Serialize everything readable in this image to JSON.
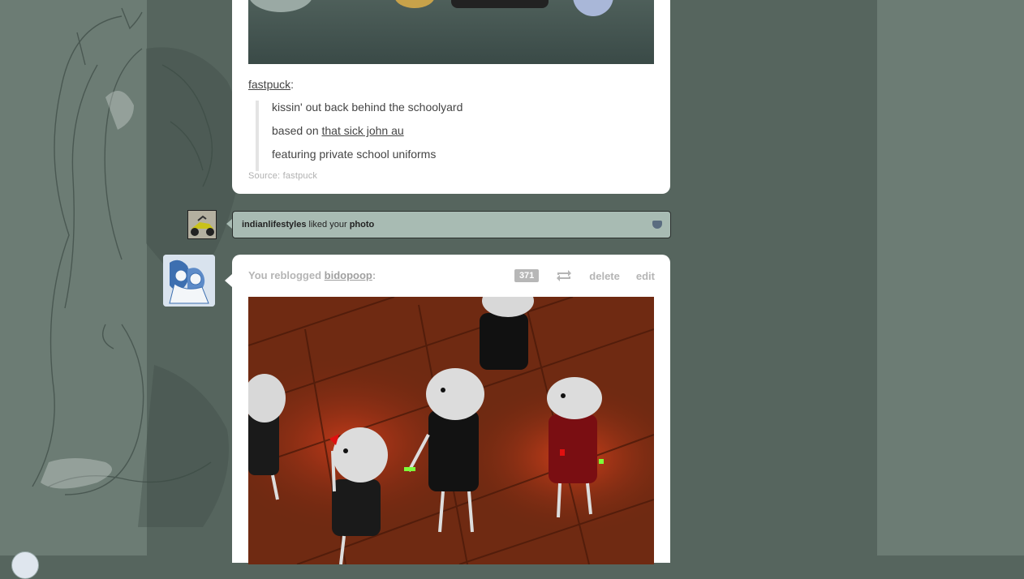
{
  "post1": {
    "caption_user": "fastpuck",
    "quote_lines": [
      {
        "text": "kissin' out back behind the schoolyard"
      },
      {
        "prefix": "based on ",
        "link": "that sick john au"
      },
      {
        "text": "featuring private school uniforms"
      }
    ],
    "source": "Source: fastpuck"
  },
  "notification": {
    "user": "indianlifestyles",
    "action": " liked your ",
    "object": "photo"
  },
  "post2": {
    "reblog_prefix": "You reblogged ",
    "reblog_user": "bidopoop",
    "reblog_suffix": ":",
    "notes_count": "371",
    "delete_label": "delete",
    "edit_label": "edit"
  },
  "colors": {
    "background": "#56655e",
    "side_panel": "#6c7c74",
    "notification_bg": "#a8bbb3",
    "card_bg": "#ffffff"
  }
}
